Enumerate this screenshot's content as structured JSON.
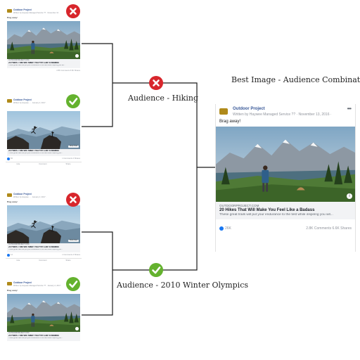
{
  "title": "Best Image - Audience Combination",
  "rounds": [
    {
      "label": "Audience - Hiking"
    },
    {
      "label": "Audience - 2010 Winter Olympics"
    }
  ],
  "colors": {
    "win": "#64b22e",
    "lose": "#d8262c",
    "line": "#1a1a1a",
    "like": "#1877f2",
    "link": "#385898"
  },
  "icons": {
    "win": "checkmark-icon",
    "lose": "x-icon"
  },
  "cards": [
    {
      "result": "lose",
      "page": "Outdoor Project",
      "meta": "Written by Haywee Managed Service ?? · November 13 ·",
      "caption": "Brag away!",
      "scene": "hiker-lake",
      "domain": "OUTDOORPROJECT.COM",
      "headline": "20 Hikes That Will Make You Feel Like a Badass",
      "description": "These great trails will put your endurance to the test while inspiring you wit...",
      "likes": "",
      "stats": "2.8K Comments  6.6K Shares",
      "actions": [],
      "badge": ""
    },
    {
      "result": "win",
      "page": "Outdoor Project",
      "meta": "Written by Haywee ... · January 2, 2017 ·",
      "caption": "",
      "scene": "jumper",
      "domain": "",
      "headline": "20 Hikes That Will Make You Feel Like a Badass",
      "description": "These great trails will put your endurance to the test while inspiring you...",
      "likes": "84",
      "stats": "1 Comments  4 Shares",
      "actions": [
        "Like",
        "Comment",
        "Share"
      ],
      "badge": "Shop Now"
    },
    {
      "result": "lose",
      "page": "Outdoor Project",
      "meta": "Written by Haywee ... · January 2, 2017 ·",
      "caption": "Brag away!",
      "scene": "jumper",
      "domain": "OUTDOORPROJECT.COM",
      "headline": "20 Hikes That Will Make You Feel Like a Badass",
      "description": "These great trails will put your endurance to the test while inspiring you...",
      "likes": "14",
      "stats": "1 Comments  4 Shares",
      "actions": [
        "Like",
        "Comment",
        "Share"
      ],
      "badge": "Book Now"
    },
    {
      "result": "win",
      "page": "Outdoor Project",
      "meta": "Written by Haywee Managed Service ?? · January 2, 2017 ·",
      "caption": "Brag away!",
      "scene": "hiker-lake",
      "domain": "OUTDOORPROJECT.COM",
      "headline": "20 Hikes That Will Make You Feel Like a Badass",
      "description": "These great trails will put your endurance to the test while inspiring you...",
      "likes": "",
      "stats": "",
      "actions": [],
      "badge": ""
    }
  ],
  "winner": {
    "page": "Outdoor Project",
    "meta": "Written by Haywee Managed Service ?? · November 13, 2016 ·",
    "more": "•••",
    "caption": "Brag away!",
    "scene": "hiker-lake",
    "domain": "OUTDOORPROJECT.COM",
    "headline": "20 Hikes That Will Make You Feel Like a Badass",
    "description": "These great trails will put your endurance to the test while inspiring you wit...",
    "likes": "26K",
    "stats": "2.8K Comments  6.6K Shares",
    "info": "i"
  }
}
